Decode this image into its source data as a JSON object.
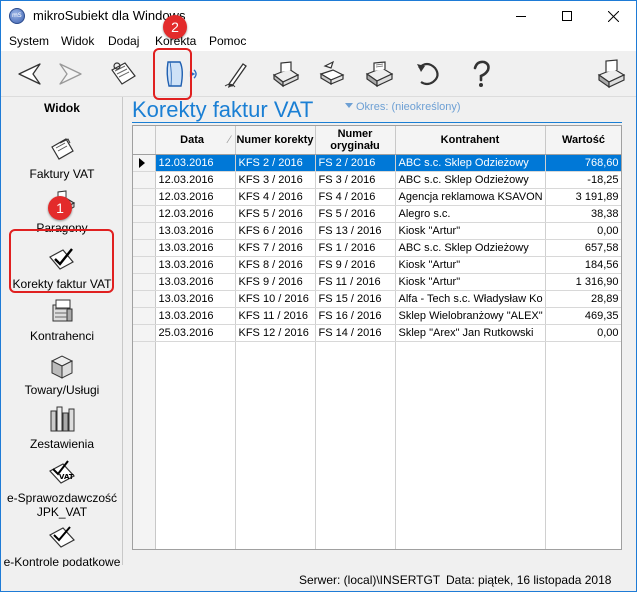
{
  "window": {
    "title": "mikroSubiekt dla Windows",
    "icon_text": "mS"
  },
  "menu": [
    "System",
    "Widok",
    "Dodaj",
    "Korekta",
    "Pomoc"
  ],
  "sidebar": {
    "title": "Widok",
    "items": [
      {
        "label": "Faktury VAT",
        "icon": "invoice-icon"
      },
      {
        "label": "Paragony",
        "icon": "receipt-icon"
      },
      {
        "label": "Korekty faktur VAT",
        "icon": "correction-icon"
      },
      {
        "label": "Kontrahenci",
        "icon": "contractors-icon"
      },
      {
        "label": "Towary/Usługi",
        "icon": "goods-icon"
      },
      {
        "label": "Zestawienia",
        "icon": "reports-icon"
      },
      {
        "label": "e-Sprawozdawczość JPK_VAT",
        "icon": "jpk-icon"
      },
      {
        "label": "e-Kontrole podatkowe",
        "icon": "tax-control-icon"
      }
    ]
  },
  "main": {
    "heading": "Korekty faktur VAT",
    "period": "Okres: (nieokreślony)",
    "columns": [
      "Data",
      "Numer korekty",
      "Numer oryginału",
      "Kontrahent",
      "Wartość"
    ],
    "rows": [
      [
        "12.03.2016",
        "KFS 2 / 2016",
        "FS 2 / 2016",
        "ABC s.c. Sklep Odzieżowy",
        "768,60"
      ],
      [
        "12.03.2016",
        "KFS 3 / 2016",
        "FS 3 / 2016",
        "ABC s.c. Sklep Odzieżowy",
        "-18,25"
      ],
      [
        "12.03.2016",
        "KFS 4 / 2016",
        "FS 4 / 2016",
        "Agencja reklamowa KSAVON",
        "3 191,89"
      ],
      [
        "12.03.2016",
        "KFS 5 / 2016",
        "FS 5 / 2016",
        "Alegro s.c.",
        "38,38"
      ],
      [
        "13.03.2016",
        "KFS 6 / 2016",
        "FS 13 / 2016",
        "Kiosk \"Artur\"",
        "0,00"
      ],
      [
        "13.03.2016",
        "KFS 7 / 2016",
        "FS 1 / 2016",
        "ABC s.c. Sklep Odzieżowy",
        "657,58"
      ],
      [
        "13.03.2016",
        "KFS 8 / 2016",
        "FS 9 / 2016",
        "Kiosk \"Artur\"",
        "184,56"
      ],
      [
        "13.03.2016",
        "KFS 9 / 2016",
        "FS 11 / 2016",
        "Kiosk \"Artur\"",
        "1 316,90"
      ],
      [
        "13.03.2016",
        "KFS 10 / 2016",
        "FS 15 / 2016",
        "Alfa - Tech s.c. Władysław Ko",
        "28,89"
      ],
      [
        "13.03.2016",
        "KFS 11 / 2016",
        "FS 16 / 2016",
        "Sklep Wielobranżowy  \"ALEX\"",
        "469,35"
      ],
      [
        "25.03.2016",
        "KFS 12 / 2016",
        "FS 14 / 2016",
        "Sklep \"Arex\" Jan Rutkowski",
        "0,00"
      ]
    ],
    "selected_row": 0
  },
  "annotations": {
    "badge1": "1",
    "badge2": "2",
    "color": "#e32b2b"
  },
  "status": {
    "server": "Serwer: (local)\\INSERTGT",
    "date": "Data: piątek, 16 listopada 2018"
  },
  "colors": {
    "accent": "#1a7fd4",
    "selection": "#0078d7"
  }
}
